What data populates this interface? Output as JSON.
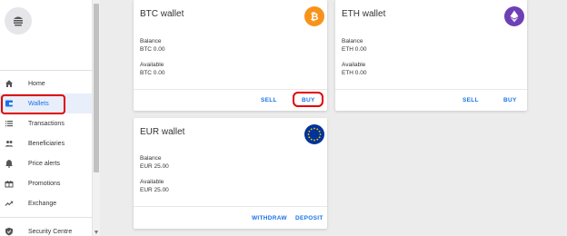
{
  "sidebar": {
    "items": [
      {
        "label": "Home",
        "icon": "home-icon"
      },
      {
        "label": "Wallets",
        "icon": "wallet-icon"
      },
      {
        "label": "Transactions",
        "icon": "list-icon"
      },
      {
        "label": "Beneficiaries",
        "icon": "people-icon"
      },
      {
        "label": "Price alerts",
        "icon": "bell-icon"
      },
      {
        "label": "Promotions",
        "icon": "gift-icon"
      },
      {
        "label": "Exchange",
        "icon": "trending-icon"
      },
      {
        "label": "Security Centre",
        "icon": "shield-icon"
      }
    ],
    "active": "Wallets"
  },
  "wallets": [
    {
      "title": "BTC wallet",
      "balance_label": "Balance",
      "balance_value": "BTC 0.00",
      "available_label": "Available",
      "available_value": "BTC 0.00",
      "actions": [
        "SELL",
        "BUY"
      ],
      "logo_color": "#f7931a"
    },
    {
      "title": "ETH wallet",
      "balance_label": "Balance",
      "balance_value": "ETH 0.00",
      "available_label": "Available",
      "available_value": "ETH 0.00",
      "actions": [
        "SELL",
        "BUY"
      ],
      "logo_color": "#6f3fb5"
    },
    {
      "title": "EUR wallet",
      "balance_label": "Balance",
      "balance_value": "EUR 25.00",
      "available_label": "Available",
      "available_value": "EUR 25.00",
      "actions": [
        "WITHDRAW",
        "DEPOSIT"
      ],
      "logo_color": "#003399"
    }
  ],
  "colors": {
    "accent": "#1a73e8",
    "annotation": "#e00000"
  }
}
